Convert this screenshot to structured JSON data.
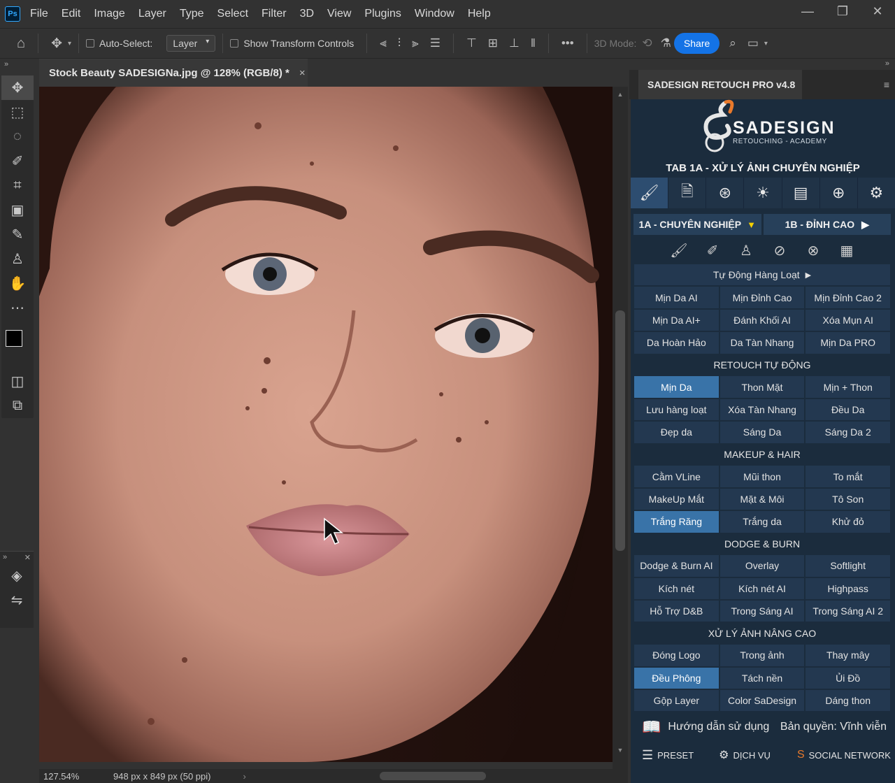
{
  "app": {
    "logo": "Ps",
    "menu": [
      "File",
      "Edit",
      "Image",
      "Layer",
      "Type",
      "Select",
      "Filter",
      "3D",
      "View",
      "Plugins",
      "Window",
      "Help"
    ]
  },
  "options_bar": {
    "auto_select_label": "Auto-Select:",
    "auto_select_value": "Layer",
    "show_transform_label": "Show Transform Controls",
    "more_label": "•••",
    "mode_3d_label": "3D Mode:",
    "share_label": "Share"
  },
  "document": {
    "tab_title": "Stock Beauty SADESIGNa.jpg @ 128% (RGB/8) *",
    "close": "×"
  },
  "status": {
    "zoom": "127.54%",
    "dimensions": "948 px x 849 px (50 ppi)"
  },
  "panel": {
    "title": "SADESIGN RETOUCH PRO v4.8",
    "logo_name": "SADESIGN",
    "logo_sub": "RETOUCHING - ACADEMY",
    "tab_title": "TAB 1A - XỬ LÝ ẢNH CHUYÊN NGHIỆP",
    "subtab_a": "1A - CHUYÊN NGHIỆP",
    "subtab_b": "1B - ĐỈNH CAO",
    "auto_batch": "Tự Động Hàng Loạt",
    "rows1": [
      [
        "Mịn Da AI",
        "Mịn Đỉnh Cao",
        "Mịn Đỉnh Cao 2"
      ],
      [
        "Mịn Da AI+",
        "Đánh Khối AI",
        "Xóa Mụn AI"
      ],
      [
        "Da Hoàn Hảo",
        "Da Tàn Nhang",
        "Mịn Da PRO"
      ]
    ],
    "section_retouch": "RETOUCH TỰ ĐỘNG",
    "rows2": [
      [
        "Mịn Da",
        "Thon Mặt",
        "Mịn + Thon"
      ],
      [
        "Lưu hàng loạt",
        "Xóa Tàn Nhang",
        "Đều Da"
      ],
      [
        "Đẹp da",
        "Sáng Da",
        "Sáng Da 2"
      ]
    ],
    "section_makeup": "MAKEUP & HAIR",
    "rows3": [
      [
        "Cằm VLine",
        "Mũi thon",
        "To mắt"
      ],
      [
        "MakeUp Mắt",
        "Mặt & Môi",
        "Tô Son"
      ],
      [
        "Trắng Răng",
        "Trắng da",
        "Khử đỏ"
      ]
    ],
    "section_dodge": "DODGE & BURN",
    "rows4": [
      [
        "Dodge & Burn AI",
        "Overlay",
        "Softlight"
      ],
      [
        "Kích nét",
        "Kích nét AI",
        "Highpass"
      ],
      [
        "Hỗ Trợ D&B",
        "Trong Sáng AI",
        "Trong Sáng AI 2"
      ]
    ],
    "section_advanced": "XỬ LÝ ẢNH NÂNG CAO",
    "rows5": [
      [
        "Đóng Logo",
        "Trong ảnh",
        "Thay mây"
      ],
      [
        "Đều Phông",
        "Tách nền",
        "Ủi Đồ"
      ],
      [
        "Gộp Layer",
        "Color SaDesign",
        "Dáng thon"
      ]
    ],
    "guide": "Hướng dẫn sử dụng",
    "license": "Bản quyền: Vĩnh viễn",
    "preset": "PRESET",
    "service": "DỊCH VỤ",
    "social": "SOCIAL NETWORK"
  }
}
